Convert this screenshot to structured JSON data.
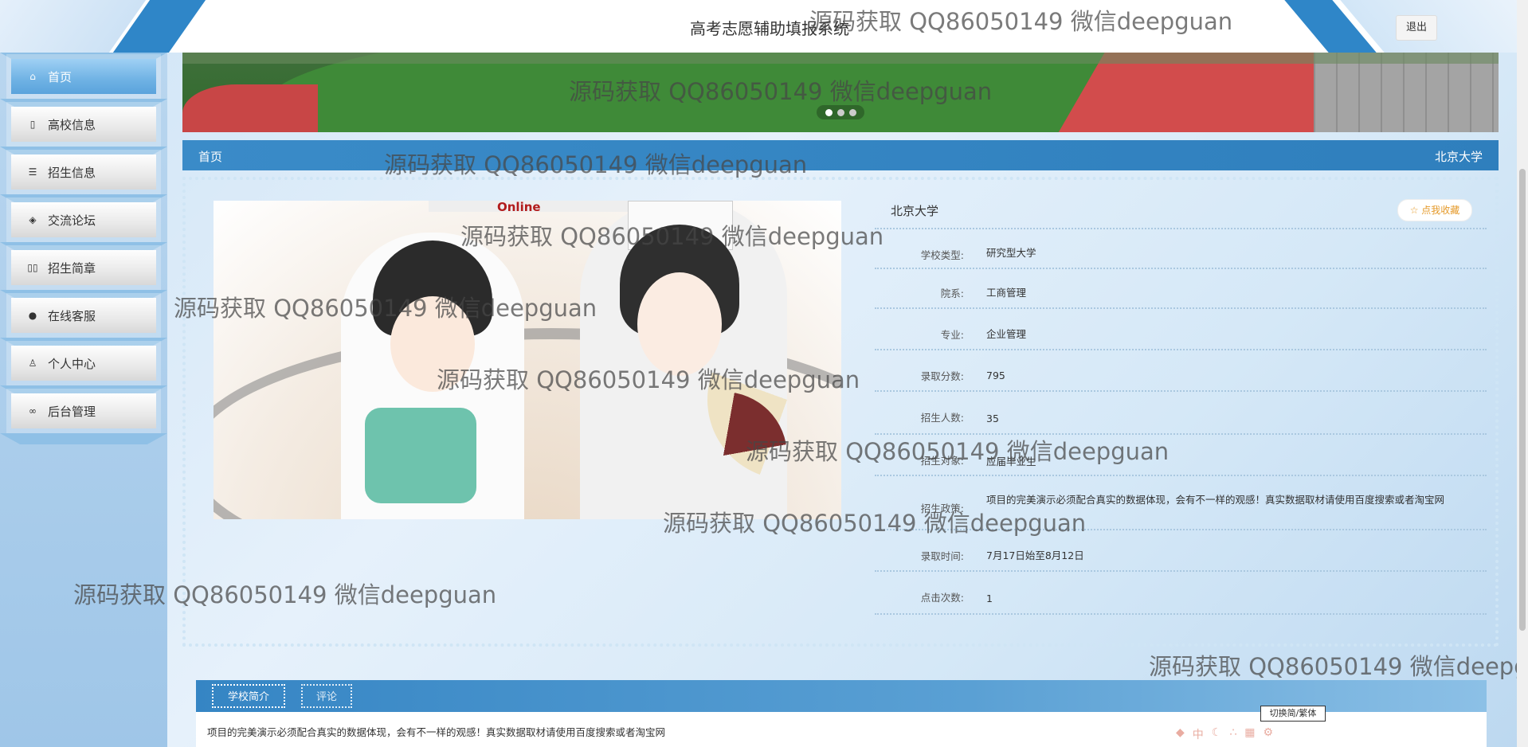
{
  "header": {
    "site_title": "高考志愿辅助填报系统",
    "logout_label": "退出"
  },
  "sidebar": {
    "items": [
      {
        "label": "首页",
        "icon": "home-icon"
      },
      {
        "label": "高校信息",
        "icon": "document-icon"
      },
      {
        "label": "招生信息",
        "icon": "sliders-icon"
      },
      {
        "label": "交流论坛",
        "icon": "layers-icon"
      },
      {
        "label": "招生简章",
        "icon": "columns-icon"
      },
      {
        "label": "在线客服",
        "icon": "chat-icon"
      },
      {
        "label": "个人中心",
        "icon": "user-icon"
      },
      {
        "label": "后台管理",
        "icon": "link-icon"
      }
    ]
  },
  "banner": {
    "slide_count": 3,
    "active_slide": 1,
    "image_text": "Online"
  },
  "breadcrumb": {
    "home": "首页",
    "current": "北京大学"
  },
  "detail": {
    "school_name": "北京大学",
    "favorite_label": "☆ 点我收藏",
    "fields": [
      {
        "label": "学校类型:",
        "value": "研究型大学"
      },
      {
        "label": "院系:",
        "value": "工商管理"
      },
      {
        "label": "专业:",
        "value": "企业管理"
      },
      {
        "label": "录取分数:",
        "value": "795"
      },
      {
        "label": "招生人数:",
        "value": "35"
      },
      {
        "label": "招生对象:",
        "value": "应届毕业生"
      },
      {
        "label": "招生政策:",
        "value": "项目的完美演示必须配合真实的数据体现，会有不一样的观感！真实数据取材请使用百度搜索或者淘宝网"
      },
      {
        "label": "录取时间:",
        "value": "7月17日始至8月12日"
      },
      {
        "label": "点击次数:",
        "value": "1"
      }
    ]
  },
  "tabs": {
    "items": [
      "学校简介",
      "评论"
    ],
    "content": "项目的完美演示必须配合真实的数据体现，会有不一样的观感！真实数据取材请使用百度搜索或者淘宝网"
  },
  "switch_label": "切换简/繁体",
  "watermark": "源码获取 QQ86050149 微信deepguan",
  "colors": {
    "primary": "#2f7fbd",
    "favorite": "#e59a2a",
    "sidebar_active": "#5aa3dc"
  }
}
